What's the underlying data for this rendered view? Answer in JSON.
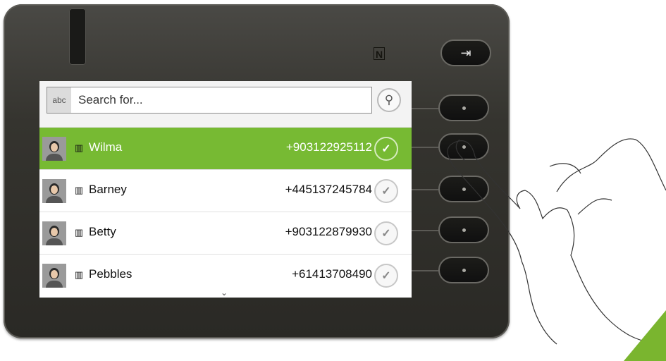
{
  "search": {
    "badge": "abc",
    "placeholder": "Search for..."
  },
  "icons": {
    "logout": "logout-arrow-icon",
    "search": "magnifier-icon",
    "nfc": "nfc-icon",
    "building": "building-icon",
    "check": "checkmark-icon",
    "more": "chevron-down-icon"
  },
  "contacts": [
    {
      "name": "Wilma",
      "number": "+903122925112",
      "selected": true
    },
    {
      "name": "Barney",
      "number": "+445137245784",
      "selected": false
    },
    {
      "name": "Betty",
      "number": "+903122879930",
      "selected": false
    },
    {
      "name": "Pebbles",
      "number": "+61413708490",
      "selected": false
    }
  ],
  "colors": {
    "selection": "#77ba33",
    "device": "#35342f",
    "accent_corner": "#7ab52f"
  }
}
